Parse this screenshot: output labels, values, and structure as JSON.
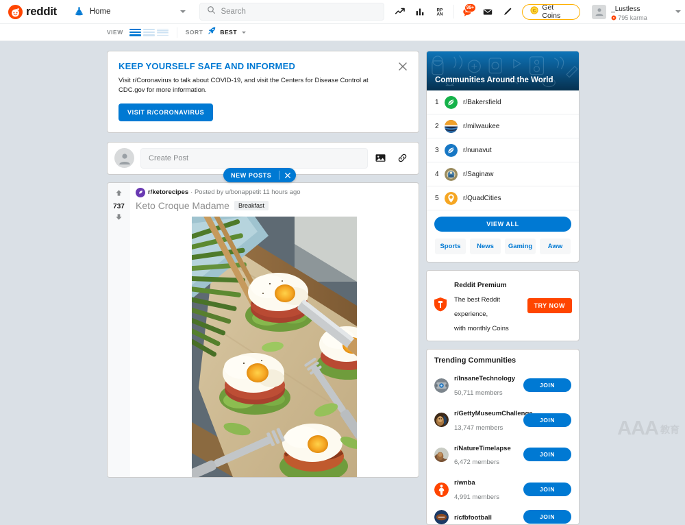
{
  "header": {
    "logo_text": "reddit",
    "logo_icon": "reddit-alien-icon",
    "home_label": "Home",
    "home_icon": "home-icon",
    "search": {
      "placeholder": "Search",
      "value": "",
      "icon": "search-icon"
    },
    "icons": [
      {
        "name": "trending-icon",
        "glyph": "trend-line"
      },
      {
        "name": "poll-chart-icon",
        "glyph": "bar-chart"
      },
      {
        "name": "reddit-public-access-network-icon",
        "glyph": "rpan-grid"
      }
    ],
    "notifications": {
      "icon": "chat-bubble-icon",
      "badge": "99+"
    },
    "mail_icon": "envelope-icon",
    "create_post_icon": "pencil-icon",
    "coins": {
      "label": "Get Coins",
      "icon": "coin-icon",
      "border_color": "#ffb000"
    },
    "user": {
      "name": "_Lustless",
      "karma": "795 karma",
      "karma_icon": "karma-flower-icon",
      "avatar_icon": "user-avatar-icon"
    },
    "dropdown_icon": "chevron-down-icon"
  },
  "toolbar": {
    "view_label": "VIEW",
    "view_options": [
      {
        "name": "card-view",
        "active": true
      },
      {
        "name": "classic-view",
        "active": false
      },
      {
        "name": "compact-view",
        "active": false
      }
    ],
    "sort_label": "SORT",
    "sort_icon": "rocket-icon",
    "sort_value": "BEST"
  },
  "covid_banner": {
    "title": "KEEP YOURSELF SAFE AND INFORMED",
    "body": "Visit r/Coronavirus to talk about COVID-19, and visit the Centers for Disease Control at CDC.gov for more information.",
    "button": "VISIT R/CORONAVIRUS",
    "close_icon": "close-icon"
  },
  "create_post": {
    "placeholder": "Create Post",
    "value": "",
    "avatar_icon": "user-avatar-icon",
    "image_icon": "image-icon",
    "link_icon": "link-icon"
  },
  "new_posts": {
    "label": "NEW POSTS",
    "close_icon": "close-icon"
  },
  "post": {
    "score": "737",
    "upvote_icon": "upvote-arrow-icon",
    "downvote_icon": "downvote-arrow-icon",
    "subreddit": "r/ketorecipes",
    "subreddit_icon": "ketorecipes-avatar-icon",
    "meta": "· Posted by u/bonappetit 11 hours ago",
    "title": "Keto Croque Madame",
    "flair": "Breakfast",
    "image_alt": "keto-croque-madame-photo"
  },
  "sidebar": {
    "communities": {
      "title": "Communities Around the World",
      "items": [
        {
          "rank": "1",
          "name": "r/Bakersfield",
          "icon": "bakersfield-leaf-icon",
          "color": "#15b24a"
        },
        {
          "rank": "2",
          "name": "r/milwaukee",
          "icon": "milwaukee-flag-icon",
          "color": "#f0a02a"
        },
        {
          "rank": "3",
          "name": "r/nunavut",
          "icon": "nunavut-leaf-icon",
          "color": "#1777c4"
        },
        {
          "rank": "4",
          "name": "r/Saginaw",
          "icon": "saginaw-seal-icon",
          "color": "#9a8b5e"
        },
        {
          "rank": "5",
          "name": "r/QuadCities",
          "icon": "quadcities-pin-icon",
          "color": "#f5a623"
        }
      ],
      "view_all": "VIEW ALL",
      "tags": [
        "Sports",
        "News",
        "Gaming",
        "Aww"
      ]
    },
    "premium": {
      "icon": "reddit-premium-shield-icon",
      "title": "Reddit Premium",
      "line1": "The best Reddit experience,",
      "line2": "with monthly Coins",
      "button": "TRY NOW"
    },
    "trending": {
      "title": "Trending Communities",
      "join_label": "JOIN",
      "items": [
        {
          "name": "r/InsaneTechnology",
          "members": "50,711 members",
          "icon": "insanetechnology-avatar-icon",
          "color": "#5b6670"
        },
        {
          "name": "r/GettyMuseumChallenge",
          "members": "13,747 members",
          "icon": "gettymuseum-avatar-icon",
          "color": "#6b4a2f"
        },
        {
          "name": "r/NatureTimelapse",
          "members": "6,472 members",
          "icon": "naturetimelapse-avatar-icon",
          "color": "#8a5a3a"
        },
        {
          "name": "r/wnba",
          "members": "4,991 members",
          "icon": "wnba-avatar-icon",
          "color": "#ff4500"
        },
        {
          "name": "r/cfbfootball",
          "members": "",
          "icon": "football-avatar-icon",
          "color": "#1b3a66"
        }
      ]
    }
  },
  "watermark": {
    "letters": "AAA",
    "cn": "教育"
  },
  "colors": {
    "brand_orange": "#ff4500",
    "link_blue": "#0079d3",
    "page_bg": "#dae0e6",
    "card_bg": "#ffffff",
    "muted_text": "#787c7e"
  }
}
